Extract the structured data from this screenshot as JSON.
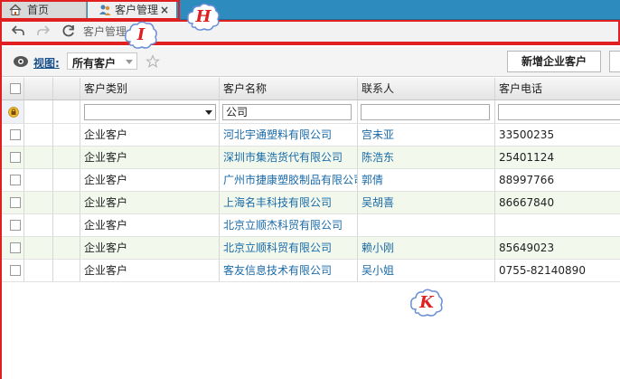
{
  "tabs": [
    {
      "label": "首页",
      "icon": "home-icon"
    },
    {
      "label": "客户管理",
      "icon": "customers-icon",
      "close": "×"
    }
  ],
  "annotations": {
    "h": "H",
    "i": "I",
    "k": "K"
  },
  "toolbar": {
    "title": "客户管理",
    "icons": [
      "back-arrow-icon",
      "forward-arrow-icon",
      "refresh-icon"
    ]
  },
  "viewbar": {
    "label": "视图:",
    "selected": "所有客户",
    "new_button": "新增企业客户"
  },
  "grid": {
    "columns": [
      "客户类别",
      "客户名称",
      "联系人",
      "客户电话"
    ],
    "filters": {
      "category": "",
      "name": "公司",
      "contact": "",
      "phone": ""
    },
    "rows": [
      [
        "企业客户",
        "河北宇通塑料有限公司",
        "宫未亚",
        "33500235"
      ],
      [
        "企业客户",
        "深圳市集浩货代有限公司",
        "陈浩东",
        "25401124"
      ],
      [
        "企业客户",
        "广州市捷康塑胶制品有限公司",
        "郭倩",
        "88997766"
      ],
      [
        "企业客户",
        "上海名丰科技有限公司",
        "吴胡喜",
        "86667840"
      ],
      [
        "企业客户",
        "北京立顺杰科贸有限公司",
        "",
        ""
      ],
      [
        "企业客户",
        "北京立顺科贸有限公司",
        "赖小刚",
        "85649023"
      ],
      [
        "企业客户",
        "客友信息技术有限公司",
        "吴小姐",
        "0755-82140890"
      ]
    ]
  },
  "colors": {
    "tabbar": "#2d8bbd",
    "annotation_red": "#e02020",
    "link": "#1a6aa8",
    "alt_row": "#f2f9ec"
  }
}
